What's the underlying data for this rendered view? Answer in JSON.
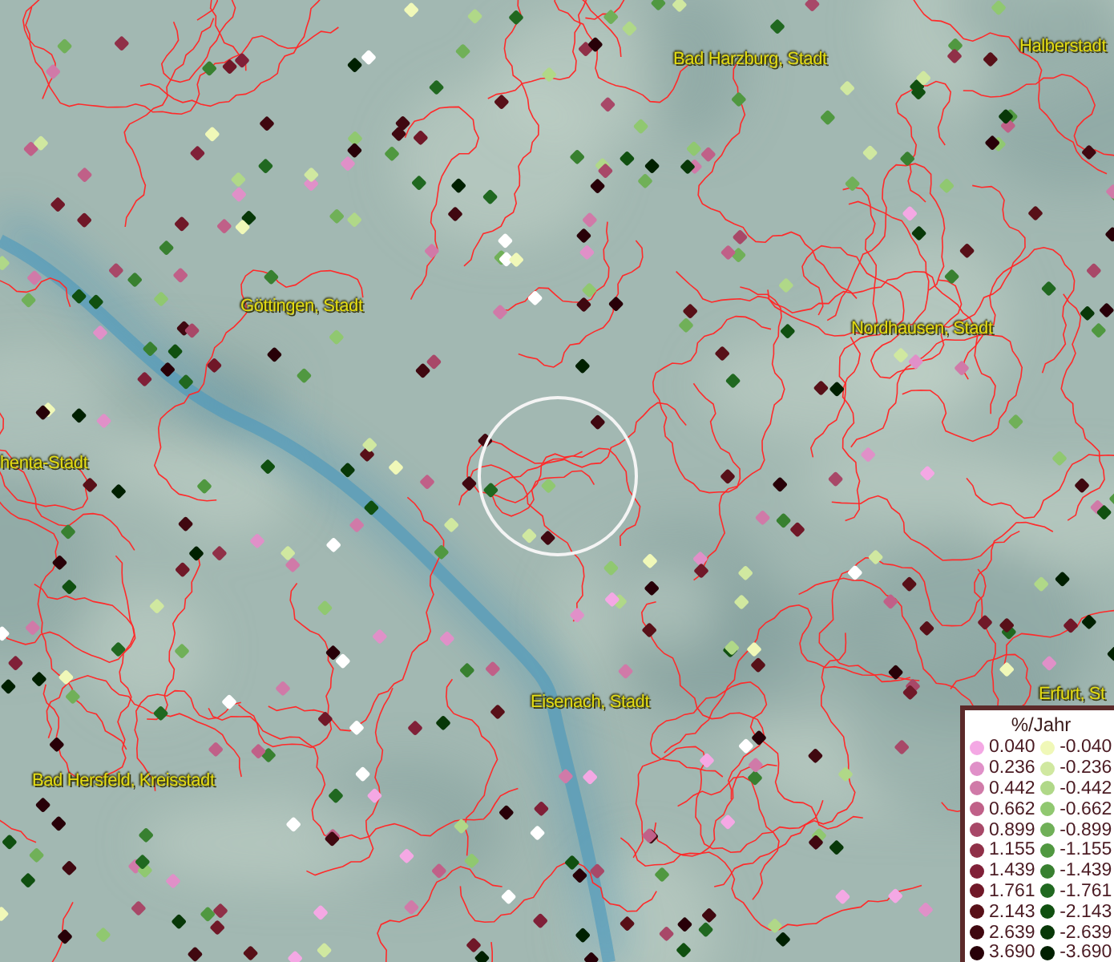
{
  "map": {
    "place_labels": [
      {
        "text": "Bad Harzburg, Stadt"
      },
      {
        "text": "Halberstadt"
      },
      {
        "text": "Göttingen, Stadt"
      },
      {
        "text": "Nordhausen, Stadt"
      },
      {
        "text": "henta-Stadt"
      },
      {
        "text": "Eisenach, Stadt"
      },
      {
        "text": "Erfurt, St"
      },
      {
        "text": "Bad Hersfeld, Kreisstadt"
      }
    ]
  },
  "legend": {
    "title": "%/Jahr",
    "rows": [
      {
        "increase": {
          "value": "0.040",
          "color": "#f4a8e4"
        },
        "decrease": {
          "value": "-0.040",
          "color": "#f0f8b8"
        }
      },
      {
        "increase": {
          "value": "0.236",
          "color": "#e090c8"
        },
        "decrease": {
          "value": "-0.236",
          "color": "#d0e8a0"
        }
      },
      {
        "increase": {
          "value": "0.442",
          "color": "#d07aa8"
        },
        "decrease": {
          "value": "-0.442",
          "color": "#b0d888"
        }
      },
      {
        "increase": {
          "value": "0.662",
          "color": "#c06088"
        },
        "decrease": {
          "value": "-0.662",
          "color": "#90c870"
        }
      },
      {
        "increase": {
          "value": "0.899",
          "color": "#a84868"
        },
        "decrease": {
          "value": "-0.899",
          "color": "#70b058"
        }
      },
      {
        "increase": {
          "value": "1.155",
          "color": "#903048"
        },
        "decrease": {
          "value": "-1.155",
          "color": "#509840"
        }
      },
      {
        "increase": {
          "value": "1.439",
          "color": "#802038"
        },
        "decrease": {
          "value": "-1.439",
          "color": "#388030"
        }
      },
      {
        "increase": {
          "value": "1.761",
          "color": "#701828"
        },
        "decrease": {
          "value": "-1.761",
          "color": "#206820"
        }
      },
      {
        "increase": {
          "value": "2.143",
          "color": "#581018"
        },
        "decrease": {
          "value": "-2.143",
          "color": "#105010"
        }
      },
      {
        "increase": {
          "value": "2.639",
          "color": "#400810"
        },
        "decrease": {
          "value": "-2.639",
          "color": "#083808"
        }
      },
      {
        "increase": {
          "value": "3.690",
          "color": "#280008"
        },
        "decrease": {
          "value": "-3.690",
          "color": "#002000"
        }
      }
    ]
  }
}
